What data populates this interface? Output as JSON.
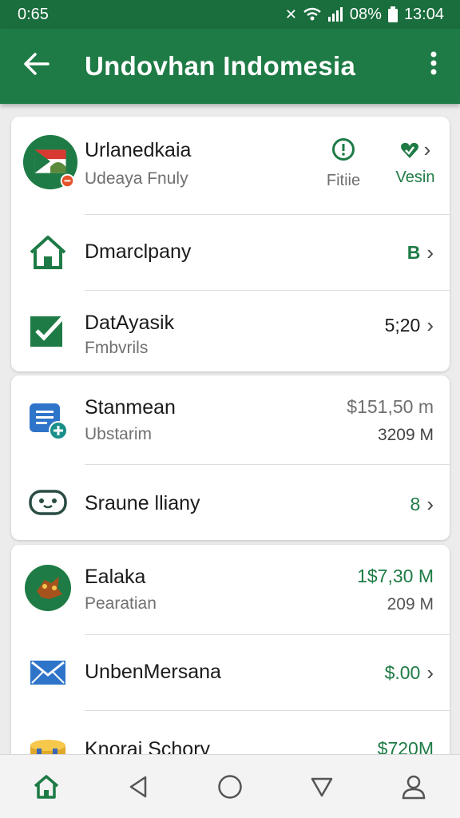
{
  "status": {
    "time_left": "0:65",
    "battery": "08%",
    "time_right": "13:04"
  },
  "appbar": {
    "title": "Undovhan  Indomesia"
  },
  "colors": {
    "primary": "#1e7b45",
    "statusbar": "#1a6d3d"
  },
  "card1": {
    "profile": {
      "title": "Urlanedkaia",
      "subtitle": "Udeaya Fnuly",
      "action1_label": "Fitiie",
      "action2_label": "Vesin"
    },
    "home_row": {
      "title": "Dmarclpany",
      "value": "B"
    },
    "task_row": {
      "title": "DatAyasik",
      "subtitle": "Fmbvrils",
      "value": "5;20"
    }
  },
  "card2": {
    "row1": {
      "title": "Stanmean",
      "subtitle": "Ubstarim",
      "value": "$151,50 m",
      "value2": "3209 M"
    },
    "row2": {
      "title": "Sraune lliany",
      "value": "8"
    }
  },
  "card3": {
    "row1": {
      "title": "Ealaka",
      "subtitle": "Pearatian",
      "value": "1$7,30 M",
      "value2": "209 M"
    },
    "row2": {
      "title": "UnbenMersana",
      "value": "$.00"
    },
    "row3": {
      "title": "Knorai Schory",
      "value": "$720M"
    }
  },
  "icons": [
    "back-arrow-icon",
    "more-vert-icon",
    "flag-avatar-icon",
    "alert-icon",
    "heart-check-icon",
    "home-icon",
    "checkbox-icon",
    "document-add-icon",
    "gamepad-icon",
    "game-avatar-icon",
    "mail-icon",
    "coins-icon",
    "nav-home-icon",
    "nav-back-icon",
    "nav-circle-icon",
    "nav-down-icon",
    "nav-profile-icon"
  ]
}
